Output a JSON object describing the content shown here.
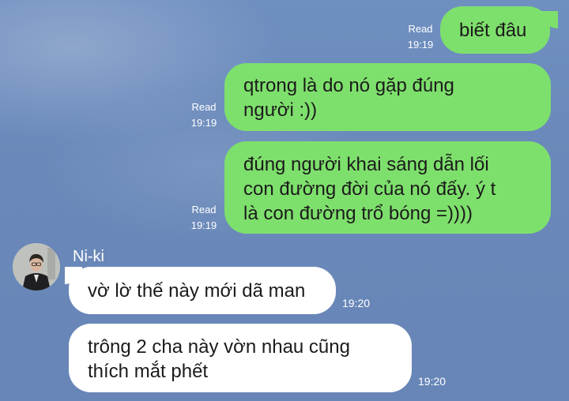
{
  "conversation": {
    "sent": [
      {
        "text": "biết đâu",
        "status": "Read",
        "time": "19:19"
      },
      {
        "line1": "qtrong là do nó gặp đúng",
        "line2": "người :))",
        "status": "Read",
        "time": "19:19"
      },
      {
        "line1": "đúng người khai sáng dẫn lối",
        "line2": "con đường đời của nó đấy. ý t",
        "line3": "là con đường trổ bóng =))))",
        "status": "Read",
        "time": "19:19"
      }
    ],
    "received": {
      "sender": "Ni-ki",
      "avatar_icon": "profile-photo",
      "messages": [
        {
          "text": "vờ lờ thế này mới dã man",
          "time": "19:20"
        },
        {
          "line1": "trông 2 cha này vờn nhau cũng",
          "line2": "thích mắt phết",
          "time": "19:20"
        }
      ]
    }
  },
  "colors": {
    "sent_bubble": "#7ee06c",
    "received_bubble": "#ffffff",
    "background": "#6a89ba"
  }
}
